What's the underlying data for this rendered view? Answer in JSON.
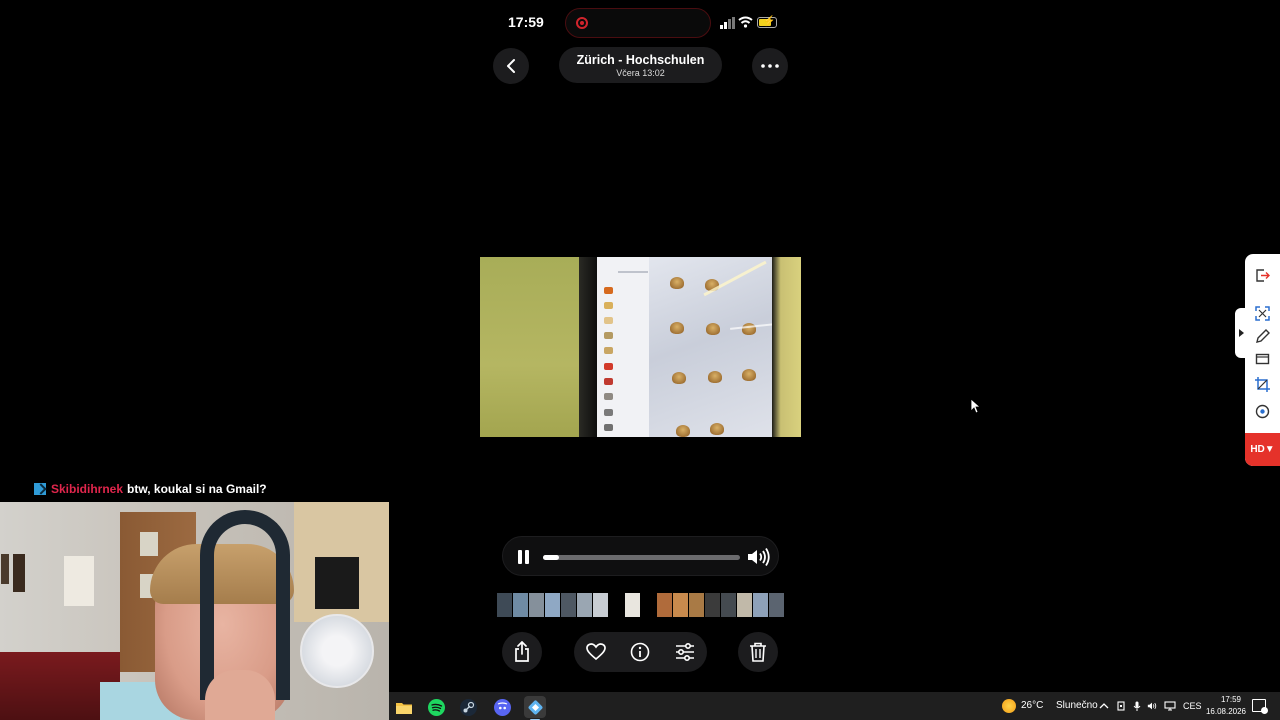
{
  "status_bar": {
    "time": "17:59"
  },
  "header": {
    "title": "Zürich - Hochschulen",
    "subtitle": "Včera 13:02",
    "back_icon": "chevron-left-icon",
    "more_icon": "ellipsis-icon"
  },
  "player": {
    "state": "playing",
    "progress": 0.08
  },
  "thumbnail_colors": [
    "#3e4a56",
    "#6f8ba4",
    "#85909b",
    "#8fa8c4",
    "#4e5863",
    "#9aa6b2",
    "#c8cdd3",
    "#000000",
    "#e9e6df",
    "#000000",
    "#b06b3b",
    "#c88a4d",
    "#a97a45",
    "#3b3b3b",
    "#444a50",
    "#c1b9a9",
    "#8ea1b9",
    "#5b6470"
  ],
  "toolbar": {
    "share_icon": "share-icon",
    "favorite_icon": "heart-icon",
    "info_icon": "info-icon",
    "adjust_icon": "sliders-icon",
    "delete_icon": "trash-icon"
  },
  "side_panel": {
    "hd_label": "HD▼"
  },
  "chat": {
    "username": "Skibidihrnek",
    "message": "btw, koukal si na Gmail?",
    "username_color": "#e0264c"
  },
  "taskbar": {
    "weather_temp": "26°C",
    "weather_desc": "Slunečno",
    "language": "CES",
    "time": "17:59",
    "date": "16.08.2026"
  }
}
